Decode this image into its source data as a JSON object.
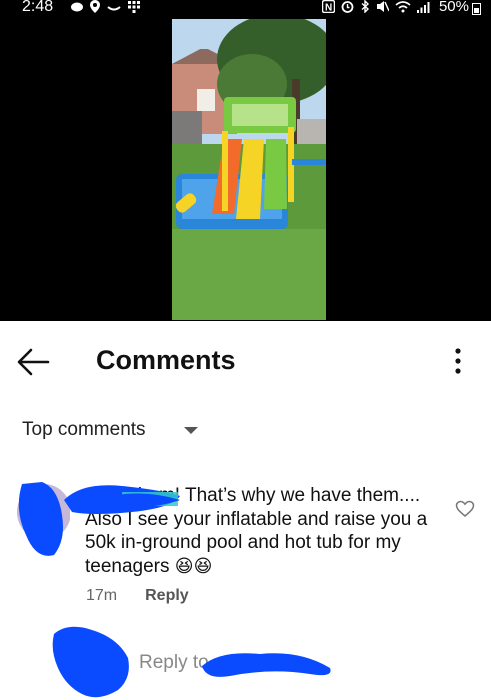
{
  "status_bar": {
    "time": "2:48",
    "battery_text": "50%",
    "left_icons": [
      "chat-icon",
      "location-icon",
      "voicemail-icon",
      "grid-icon"
    ],
    "right_icons": [
      "nfc-icon",
      "alarm-icon",
      "bluetooth-icon",
      "mute-icon",
      "wifi-icon",
      "signal-icon",
      "battery-icon"
    ]
  },
  "video": {
    "description": "thumbnail",
    "colors": {
      "sky": "#bcd7ee",
      "grass": "#5d9a3b",
      "pool": "#2a86d8",
      "slide_green": "#7ac943",
      "slide_yellow": "#f5d426"
    }
  },
  "header": {
    "title": "Comments",
    "back_icon": "back-arrow-icon",
    "menu_icon": "more-vertical-icon"
  },
  "sort": {
    "label": "Top comments"
  },
  "comment": {
    "text_main": "Spoil them! That’s why we have them.... Also I see your inflatable and raise you a 50k in-ground pool and hot tub for my teenagers",
    "emojis": [
      "😆",
      "😆"
    ],
    "age": "17m",
    "reply_label": "Reply",
    "like_icon": "heart-outline-icon"
  },
  "reply_box": {
    "placeholder": "Reply to"
  },
  "colors": {
    "redaction_blue": "#0a4bff",
    "text_primary": "#111111",
    "text_secondary": "#555555"
  }
}
